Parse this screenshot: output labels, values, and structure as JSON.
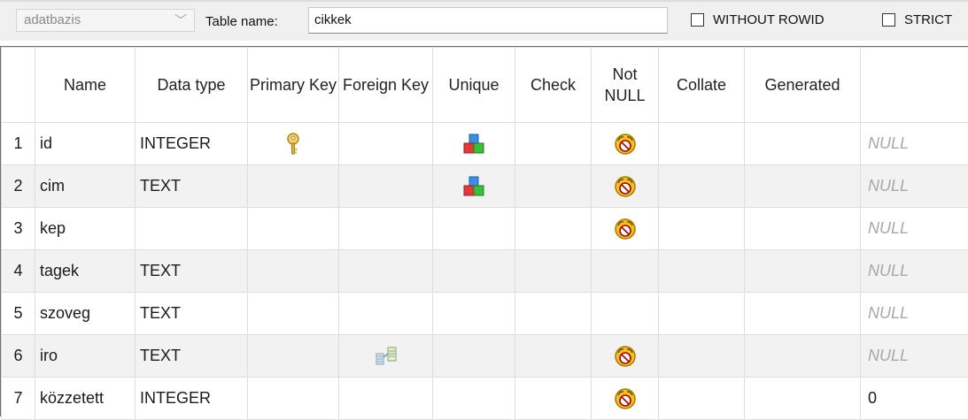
{
  "toolbar": {
    "schema_value": "adatbazis",
    "table_name_label": "Table name:",
    "table_name_value": "cikkek",
    "without_rowid_label": "WITHOUT ROWID",
    "strict_label": "STRICT"
  },
  "columns": {
    "name": "Name",
    "data_type": "Data type",
    "primary_key": "Primary Key",
    "foreign_key": "Foreign Key",
    "unique": "Unique",
    "check": "Check",
    "not_null": "Not NULL",
    "collate": "Collate",
    "generated": "Generated",
    "default": ""
  },
  "rows": [
    {
      "num": "1",
      "name": "id",
      "type": "INTEGER",
      "pk": true,
      "fk": false,
      "unique": true,
      "not_null": true,
      "default": "NULL",
      "default_is_null": true
    },
    {
      "num": "2",
      "name": "cim",
      "type": "TEXT",
      "pk": false,
      "fk": false,
      "unique": true,
      "not_null": true,
      "default": "NULL",
      "default_is_null": true
    },
    {
      "num": "3",
      "name": "kep",
      "type": "",
      "pk": false,
      "fk": false,
      "unique": false,
      "not_null": true,
      "default": "NULL",
      "default_is_null": true
    },
    {
      "num": "4",
      "name": "tagek",
      "type": "TEXT",
      "pk": false,
      "fk": false,
      "unique": false,
      "not_null": false,
      "default": "NULL",
      "default_is_null": true
    },
    {
      "num": "5",
      "name": "szoveg",
      "type": "TEXT",
      "pk": false,
      "fk": false,
      "unique": false,
      "not_null": false,
      "default": "NULL",
      "default_is_null": true
    },
    {
      "num": "6",
      "name": "iro",
      "type": "TEXT",
      "pk": false,
      "fk": true,
      "unique": false,
      "not_null": true,
      "default": "NULL",
      "default_is_null": true
    },
    {
      "num": "7",
      "name": "közzetett",
      "type": "INTEGER",
      "pk": false,
      "fk": false,
      "unique": false,
      "not_null": true,
      "default": "0",
      "default_is_null": false
    }
  ],
  "icons": {
    "primary_key": "key-icon",
    "foreign_key": "foreign-key-icon",
    "unique": "unique-blocks-icon",
    "not_null": "not-null-smiley-icon"
  }
}
